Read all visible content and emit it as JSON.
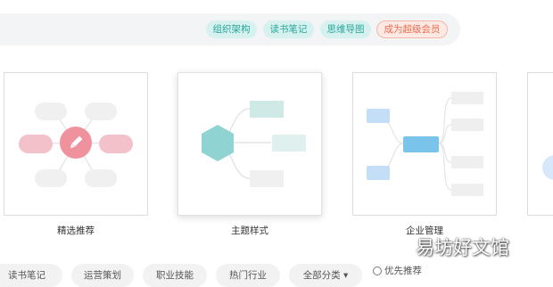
{
  "toolbar": {
    "tags": [
      "组织架构",
      "读书笔记",
      "思维导图"
    ],
    "vip_label": "成为超级会员"
  },
  "templates": [
    {
      "label": "精选推荐",
      "icon": "pencil-icon"
    },
    {
      "label": "主题样式"
    },
    {
      "label": "企业管理"
    }
  ],
  "filters": {
    "chips": [
      "读书笔记",
      "运营策划",
      "职业技能",
      "热门行业",
      "全部分类 ▾"
    ],
    "radio_label": "优先推荐"
  },
  "watermark": "易坊好文馆",
  "colors": {
    "teal": "#26a69a",
    "vip": "#ee6b4d",
    "pink": "#f0919e",
    "blue": "#7ac4ec"
  }
}
